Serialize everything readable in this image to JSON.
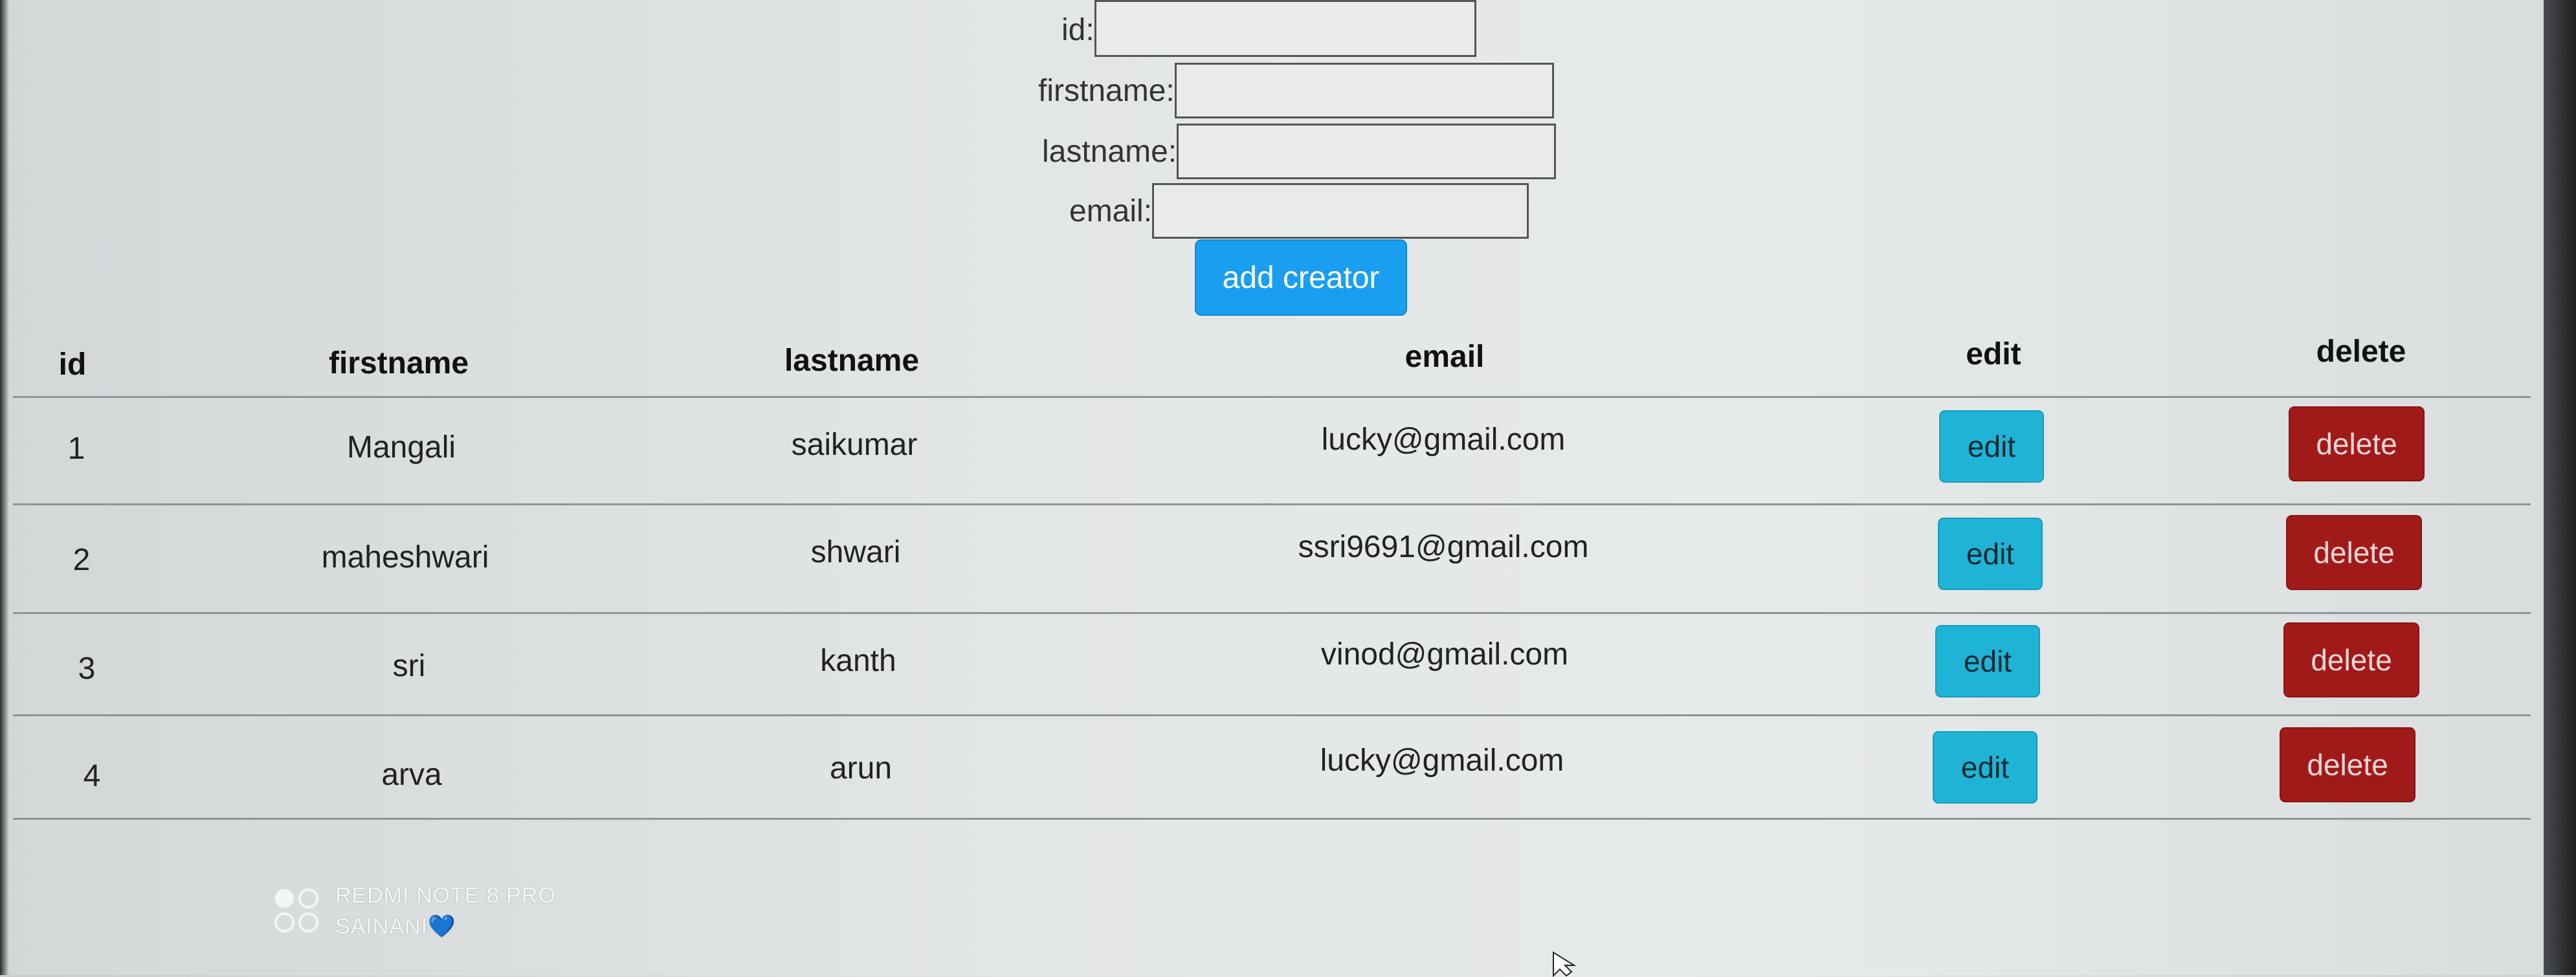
{
  "form": {
    "fields": [
      {
        "label": "id:",
        "value": ""
      },
      {
        "label": "firstname:",
        "value": ""
      },
      {
        "label": "lastname:",
        "value": ""
      },
      {
        "label": "email:",
        "value": ""
      }
    ],
    "submit_label": "add creator"
  },
  "table": {
    "headers": [
      "id",
      "firstname",
      "lastname",
      "email",
      "edit",
      "delete"
    ],
    "rows": [
      {
        "id": "1",
        "firstname": "Mangali",
        "lastname": "saikumar",
        "email": "lucky@gmail.com",
        "edit": "edit",
        "delete": "delete"
      },
      {
        "id": "2",
        "firstname": "maheshwari",
        "lastname": "shwari",
        "email": "ssri9691@gmail.com",
        "edit": "edit",
        "delete": "delete"
      },
      {
        "id": "3",
        "firstname": "sri",
        "lastname": "kanth",
        "email": "vinod@gmail.com",
        "edit": "edit",
        "delete": "delete"
      },
      {
        "id": "4",
        "firstname": "arva",
        "lastname": "arun",
        "email": "lucky@gmail.com",
        "edit": "edit",
        "delete": "delete"
      }
    ]
  },
  "watermark": {
    "line1": "REDMI NOTE 8 PRO",
    "line2": "SAINANI💙"
  },
  "colors": {
    "add_button": "#1a9ff0",
    "edit_button": "#1fb4d6",
    "delete_button": "#a11a1a"
  }
}
